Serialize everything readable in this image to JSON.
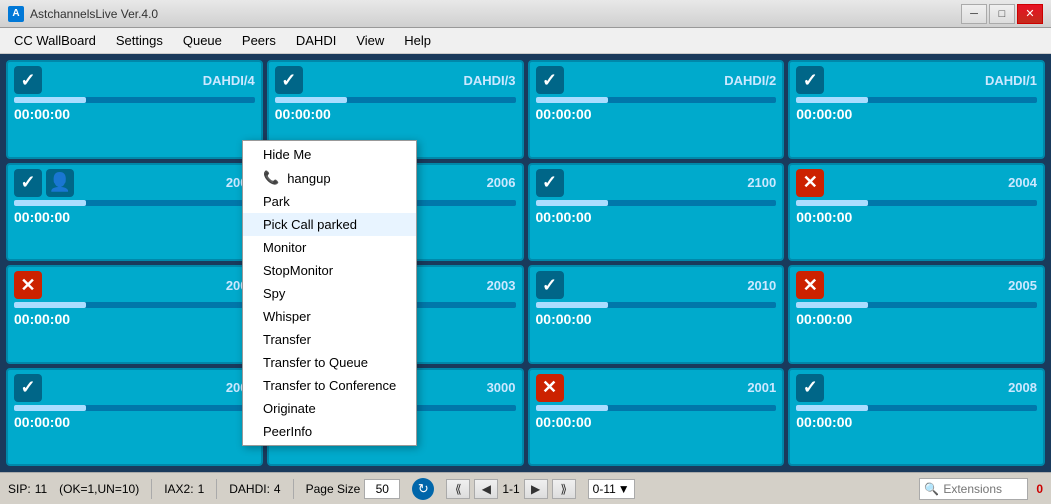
{
  "titleBar": {
    "appName": "AstchannelsLive Ver.4.0",
    "windowTitle": "AstchannelsLive Ver.4.0",
    "minBtn": "─",
    "maxBtn": "□",
    "closeBtn": "✕"
  },
  "menuBar": {
    "items": [
      "CC WallBoard",
      "Settings",
      "Queue",
      "Peers",
      "DAHDI",
      "View",
      "Help"
    ]
  },
  "cards": [
    {
      "id": "dahdi4",
      "label": "DAHDI/4",
      "time": "00:00:00",
      "icon": "check",
      "progress": 30,
      "row": 1,
      "col": 1
    },
    {
      "id": "dahdi3",
      "label": "DAHDI/3",
      "time": "00:00:00",
      "icon": "check",
      "progress": 30,
      "row": 1,
      "col": 2
    },
    {
      "id": "dahdi2",
      "label": "DAHDI/2",
      "time": "00:00:00",
      "icon": "check",
      "progress": 30,
      "row": 1,
      "col": 3
    },
    {
      "id": "dahdi1",
      "label": "DAHDI/1",
      "time": "00:00:00",
      "icon": "check",
      "progress": 30,
      "row": 1,
      "col": 4
    },
    {
      "id": "2000",
      "label": "2000",
      "time": "00:00:00",
      "icon": "check-user",
      "progress": 30,
      "row": 2,
      "col": 1
    },
    {
      "id": "2006",
      "label": "2006",
      "time": "",
      "icon": "check",
      "progress": 30,
      "row": 2,
      "col": 2
    },
    {
      "id": "2100",
      "label": "2100",
      "time": "00:00:00",
      "icon": "check",
      "progress": 30,
      "row": 2,
      "col": 3
    },
    {
      "id": "2004",
      "label": "2004",
      "time": "00:00:00",
      "icon": "cross",
      "progress": 30,
      "row": 2,
      "col": 4
    },
    {
      "id": "2002",
      "label": "2002",
      "time": "00:00:00",
      "icon": "cross",
      "progress": 30,
      "row": 3,
      "col": 1
    },
    {
      "id": "2003",
      "label": "2003",
      "time": "",
      "icon": "check",
      "progress": 30,
      "row": 3,
      "col": 2
    },
    {
      "id": "2010",
      "label": "2010",
      "time": "00:00:00",
      "icon": "check",
      "progress": 30,
      "row": 3,
      "col": 3
    },
    {
      "id": "2005",
      "label": "2005",
      "time": "00:00:00",
      "icon": "cross",
      "progress": 30,
      "row": 3,
      "col": 4
    },
    {
      "id": "2009",
      "label": "2009",
      "time": "00:00:00",
      "icon": "check",
      "progress": 30,
      "row": 4,
      "col": 1
    },
    {
      "id": "3000",
      "label": "3000",
      "time": "",
      "icon": "check",
      "progress": 30,
      "row": 4,
      "col": 2
    },
    {
      "id": "2001",
      "label": "2001",
      "time": "00:00:00",
      "icon": "cross",
      "progress": 30,
      "row": 4,
      "col": 3
    },
    {
      "id": "2008",
      "label": "2008",
      "time": "00:00:00",
      "icon": "check",
      "progress": 30,
      "row": 4,
      "col": 4
    }
  ],
  "contextMenu": {
    "items": [
      {
        "label": "Hide Me",
        "icon": null
      },
      {
        "label": "hangup",
        "icon": "phone"
      },
      {
        "label": "Park",
        "icon": null
      },
      {
        "label": "Pick Call parked",
        "icon": null
      },
      {
        "label": "Monitor",
        "icon": null
      },
      {
        "label": "StopMonitor",
        "icon": null
      },
      {
        "label": "Spy",
        "icon": null
      },
      {
        "label": "Whisper",
        "icon": null
      },
      {
        "label": "Transfer",
        "icon": null
      },
      {
        "label": "Transfer to Queue",
        "icon": null
      },
      {
        "label": "Transfer to Conference",
        "icon": null
      },
      {
        "label": "Originate",
        "icon": null
      },
      {
        "label": "PeerInfo",
        "icon": null
      }
    ]
  },
  "statusBar": {
    "sip": {
      "label": "SIP:",
      "value": "11"
    },
    "ok": {
      "label": "(OK=1,UN=10)"
    },
    "iax2": {
      "label": "IAX2:",
      "value": "1"
    },
    "dahdi": {
      "label": "DAHDI:",
      "value": "4"
    },
    "pageSize": {
      "label": "Page Size",
      "value": "50"
    },
    "pageRange": "0-11",
    "currentPage": "1-1",
    "extensionsLabel": "Extensions",
    "extensionsCount": "0"
  }
}
